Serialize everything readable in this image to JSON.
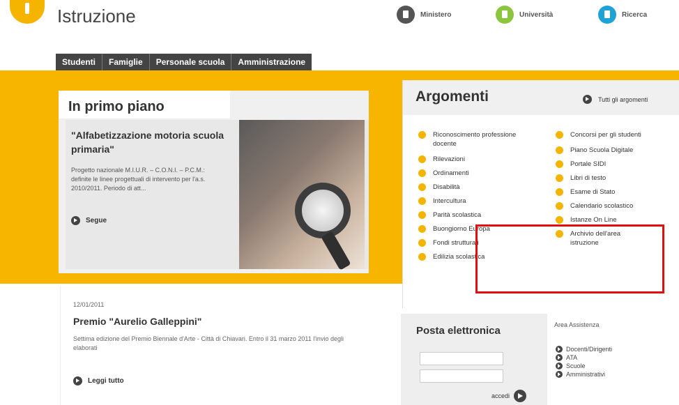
{
  "header": {
    "site_title": "Istruzione",
    "top_links": [
      {
        "label": "Ministero",
        "icon": "ministero-icon",
        "color": "#555555"
      },
      {
        "label": "Università",
        "icon": "universita-icon",
        "color": "#8cc63f"
      },
      {
        "label": "Ricerca",
        "icon": "ricerca-icon",
        "color": "#1fa3d6"
      }
    ]
  },
  "nav": {
    "tabs": [
      "Studenti",
      "Famiglie",
      "Personale scuola",
      "Amministrazione"
    ]
  },
  "primo_piano": {
    "heading": "In primo piano",
    "title": "\"Alfabetizzazione motoria scuola primaria\"",
    "text": "Progetto nazionale M.I.U.R. – C.O.N.I. – P.C.M.: definite le linee progettuali di intervento per l'a.s. 2010/2011. Periodo di att...",
    "more_label": "Segue"
  },
  "news": {
    "date": "12/01/2011",
    "title": "Premio \"Aurelio Galleppini\"",
    "text": "Settima edizione del Premio Biennale d'Arte - Città di Chiavari. Entro il 31 marzo 2011 l'invio degli elaborati",
    "more_label": "Leggi tutto"
  },
  "argomenti": {
    "title": "Argomenti",
    "all_label": "Tutti gli argomenti",
    "left": [
      "Riconoscimento professione docente",
      "Rilevazioni",
      "Ordinamenti",
      "Disabilità",
      "Intercultura",
      "Parità scolastica",
      "Buongiorno Europa",
      "Fondi strutturali",
      "Edilizia scolastica"
    ],
    "right": [
      "Concorsi per gli studenti",
      "Piano Scuola Digitale",
      "Portale SIDI",
      "Libri di testo",
      "Esame di Stato",
      "Calendario scolastico",
      "Istanze On Line",
      "Archivio dell'area istruzione"
    ]
  },
  "posta": {
    "title": "Posta elettronica",
    "submit_label": "accedi"
  },
  "assistenza": {
    "title": "Area Assistenza",
    "items": [
      "Docenti/Dirigenti",
      "ATA",
      "Scuole",
      "Amministrativi"
    ]
  },
  "colors": {
    "accent": "#f7b500",
    "nav_bg": "#444444",
    "highlight": "#e01010"
  }
}
